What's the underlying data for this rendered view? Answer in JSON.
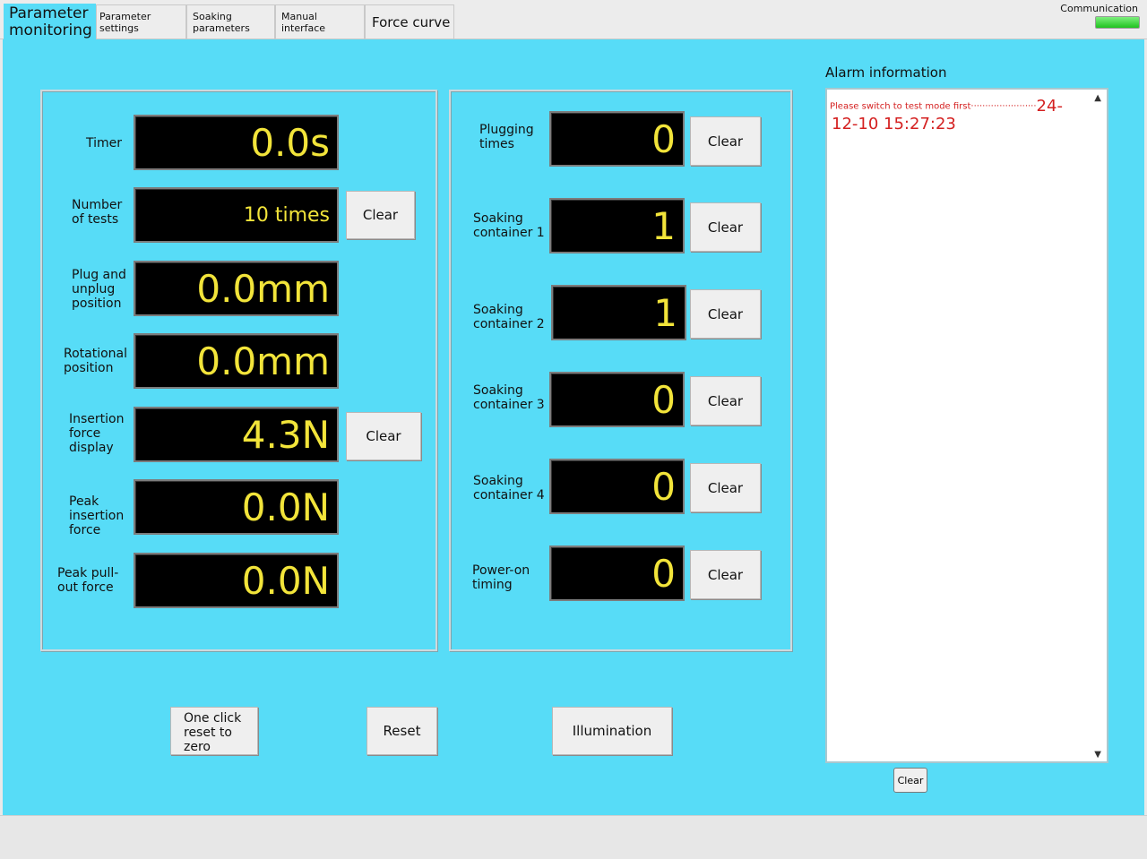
{
  "tabs": [
    {
      "label": "Parameter monitoring",
      "active": true
    },
    {
      "label": "Parameter settings"
    },
    {
      "label": "Soaking parameters"
    },
    {
      "label": "Manual interface"
    },
    {
      "label": "Force curve"
    }
  ],
  "status": {
    "communication_label": "Communication",
    "communication_color": "#33cc33"
  },
  "left_panel": {
    "timer": {
      "label": "Timer",
      "value": "0.0s"
    },
    "number_of_tests": {
      "label": "Number of tests",
      "value": "10 times",
      "clear": "Clear"
    },
    "plug_unplug_position": {
      "label": "Plug and unplug position",
      "value": "0.0mm"
    },
    "rotational_position": {
      "label": "Rotational position",
      "value": "0.0mm"
    },
    "insertion_force": {
      "label": "Insertion force display",
      "value": "4.3N",
      "clear": "Clear"
    },
    "peak_insertion_force": {
      "label": "Peak insertion force",
      "value": "0.0N"
    },
    "peak_pullout_force": {
      "label": "Peak pull-out force",
      "value": "0.0N"
    }
  },
  "right_panel": {
    "plugging_times": {
      "label": "Plugging times",
      "value": "0",
      "clear": "Clear"
    },
    "soaking_container_1": {
      "label": "Soaking container 1",
      "value": "1",
      "clear": "Clear"
    },
    "soaking_container_2": {
      "label": "Soaking container 2",
      "value": "1",
      "clear": "Clear"
    },
    "soaking_container_3": {
      "label": "Soaking container 3",
      "value": "0",
      "clear": "Clear"
    },
    "soaking_container_4": {
      "label": "Soaking container 4",
      "value": "0",
      "clear": "Clear"
    },
    "power_on_timing": {
      "label": "Power-on timing",
      "value": "0",
      "clear": "Clear"
    }
  },
  "bottom_buttons": {
    "one_click_reset": "One click reset to zero",
    "reset": "Reset",
    "illumination": "Illumination"
  },
  "alarm": {
    "title": "Alarm information",
    "message": "Please switch to test mode first",
    "dots": "·······················",
    "year_fragment": "24-",
    "datetime": "12-10 15:27:23",
    "clear": "Clear"
  },
  "colors": {
    "background": "#57dcf7",
    "display_text": "#f2e43a",
    "alarm_text": "#d42020"
  }
}
